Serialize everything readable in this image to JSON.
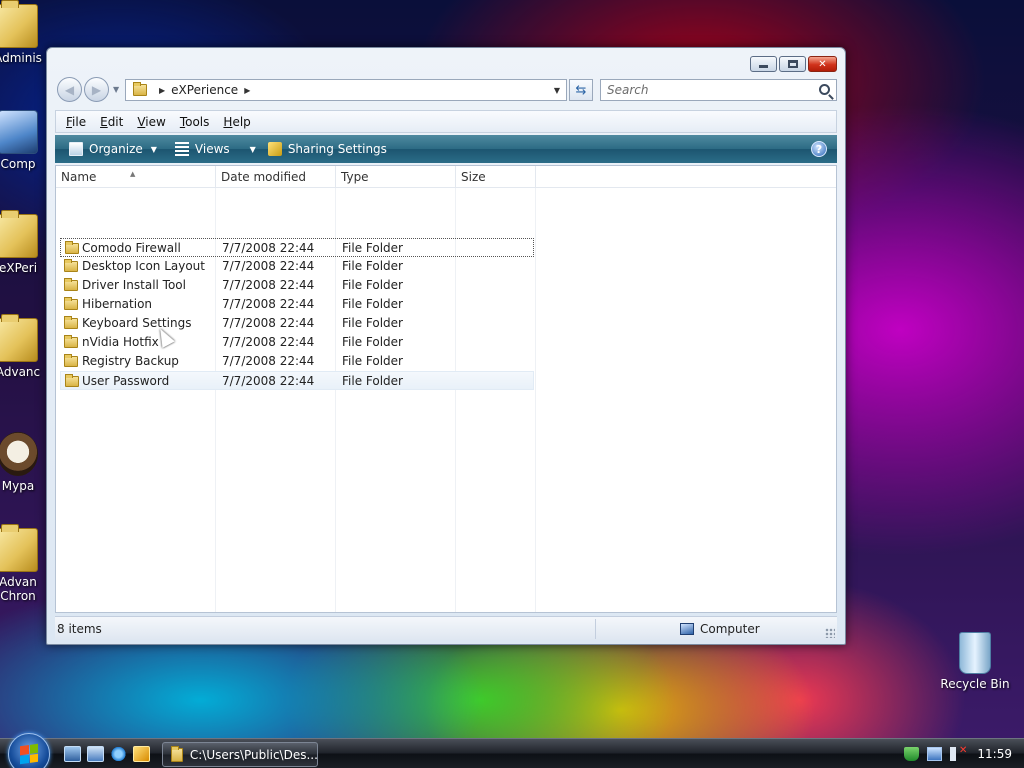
{
  "desktop": {
    "icons_left": [
      {
        "label": "Adminis",
        "kind": "folder"
      },
      {
        "label": "Comp",
        "kind": "computer"
      },
      {
        "label": "eXPeri",
        "kind": "folder"
      },
      {
        "label": "Advanc",
        "kind": "folder"
      },
      {
        "label": "Mypa",
        "kind": "shortcut"
      },
      {
        "label": "Advan\nChron",
        "kind": "folder"
      }
    ],
    "recycle_bin": {
      "label": "Recycle Bin",
      "icon": "recycle-bin-icon"
    }
  },
  "window": {
    "controls": {
      "minimize": "minimize",
      "maximize": "maximize",
      "close": "✕"
    },
    "address": {
      "crumbs": [
        "eXPerience"
      ]
    },
    "search": {
      "placeholder": "Search"
    },
    "menu": [
      "File",
      "Edit",
      "View",
      "Tools",
      "Help"
    ],
    "commands": {
      "organize": "Organize",
      "views": "Views",
      "sharing": "Sharing Settings",
      "help": "?"
    },
    "columns": [
      "Name",
      "Date modified",
      "Type",
      "Size"
    ],
    "files": [
      {
        "name": "Comodo Firewall",
        "date": "7/7/2008 22:44",
        "type": "File Folder"
      },
      {
        "name": "Desktop Icon Layout",
        "date": "7/7/2008 22:44",
        "type": "File Folder"
      },
      {
        "name": "Driver Install Tool",
        "date": "7/7/2008 22:44",
        "type": "File Folder"
      },
      {
        "name": "Hibernation",
        "date": "7/7/2008 22:44",
        "type": "File Folder"
      },
      {
        "name": "Keyboard Settings",
        "date": "7/7/2008 22:44",
        "type": "File Folder"
      },
      {
        "name": "nVidia Hotfix",
        "date": "7/7/2008 22:44",
        "type": "File Folder"
      },
      {
        "name": "Registry Backup",
        "date": "7/7/2008 22:44",
        "type": "File Folder"
      },
      {
        "name": "User Password",
        "date": "7/7/2008 22:44",
        "type": "File Folder"
      }
    ],
    "status": {
      "count": "8 items",
      "zone": "Computer"
    }
  },
  "taskbar": {
    "task_label": "C:\\Users\\Public\\Des...",
    "clock": "11:59"
  },
  "colors": {
    "accent": "#2c6b84",
    "flag_red": "#f25022",
    "flag_green": "#7fba00",
    "flag_blue": "#00a4ef",
    "flag_yellow": "#ffb900"
  }
}
